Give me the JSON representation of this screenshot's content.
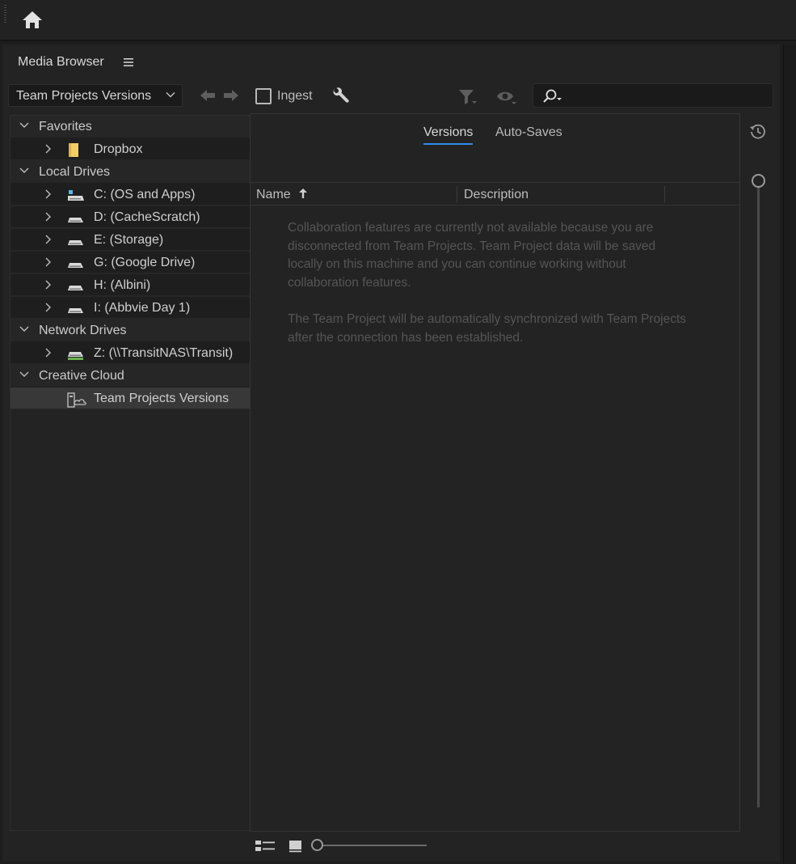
{
  "panel": {
    "title": "Media Browser"
  },
  "toolbar": {
    "dropdown_value": "Team Projects Versions",
    "ingest_label": "Ingest",
    "search_placeholder": ""
  },
  "tree": {
    "groups": [
      {
        "label": "Favorites",
        "items": [
          {
            "label": "Dropbox",
            "icon": "folder-icon"
          }
        ]
      },
      {
        "label": "Local Drives",
        "items": [
          {
            "label": "C: (OS and Apps)",
            "icon": "system-drive-icon"
          },
          {
            "label": "D: (CacheScratch)",
            "icon": "drive-icon"
          },
          {
            "label": "E: (Storage)",
            "icon": "drive-icon"
          },
          {
            "label": "G: (Google Drive)",
            "icon": "drive-icon"
          },
          {
            "label": "H: (Albini)",
            "icon": "drive-icon"
          },
          {
            "label": "I: (Abbvie Day 1)",
            "icon": "drive-icon"
          }
        ]
      },
      {
        "label": "Network Drives",
        "items": [
          {
            "label": "Z: (\\\\TransitNAS\\Transit)",
            "icon": "network-drive-icon"
          }
        ]
      },
      {
        "label": "Creative Cloud",
        "items": [
          {
            "label": "Team Projects Versions",
            "icon": "team-projects-icon",
            "selected": true
          }
        ]
      }
    ]
  },
  "content": {
    "tabs": [
      {
        "label": "Versions",
        "active": true
      },
      {
        "label": "Auto-Saves",
        "active": false
      }
    ],
    "columns": {
      "name": "Name",
      "description": "Description"
    },
    "message": [
      "Collaboration features are currently not available because you are disconnected from Team Projects. Team Project data will be saved locally on this machine and you can continue working without collaboration features.",
      "The Team Project will be automatically synchronized with Team Projects after the connection has been established."
    ]
  },
  "colors": {
    "accent": "#2d8ceb",
    "background": "#232323"
  }
}
